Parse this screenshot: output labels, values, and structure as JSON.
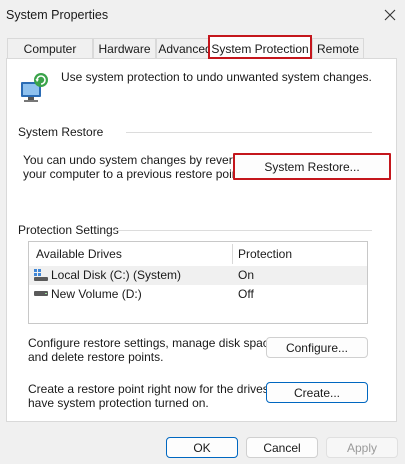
{
  "window": {
    "title": "System Properties"
  },
  "tabs": [
    {
      "label": "Computer Name"
    },
    {
      "label": "Hardware"
    },
    {
      "label": "Advanced"
    },
    {
      "label": "System Protection"
    },
    {
      "label": "Remote"
    }
  ],
  "active_tab": "System Protection",
  "intro": {
    "text": "Use system protection to undo unwanted system changes."
  },
  "system_restore": {
    "heading": "System Restore",
    "description_line1": "You can undo system changes by reverting",
    "description_line2": "your computer to a previous restore point.",
    "button_label": "System Restore..."
  },
  "protection": {
    "heading": "Protection Settings",
    "columns": [
      "Available Drives",
      "Protection"
    ],
    "drives": [
      {
        "name": "Local Disk (C:) (System)",
        "protection": "On",
        "icon": "system-drive-icon",
        "selected": true
      },
      {
        "name": "New Volume (D:)",
        "protection": "Off",
        "icon": "drive-icon",
        "selected": false
      }
    ],
    "configure_text_line1": "Configure restore settings, manage disk space,",
    "configure_text_line2": "and delete restore points.",
    "configure_label": "Configure...",
    "create_text_line1": "Create a restore point right now for the drives that",
    "create_text_line2": "have system protection turned on.",
    "create_label": "Create..."
  },
  "footer": {
    "ok": "OK",
    "cancel": "Cancel",
    "apply": "Apply"
  },
  "colors": {
    "highlight_box": "#c4161c",
    "accent": "#0067c0"
  }
}
